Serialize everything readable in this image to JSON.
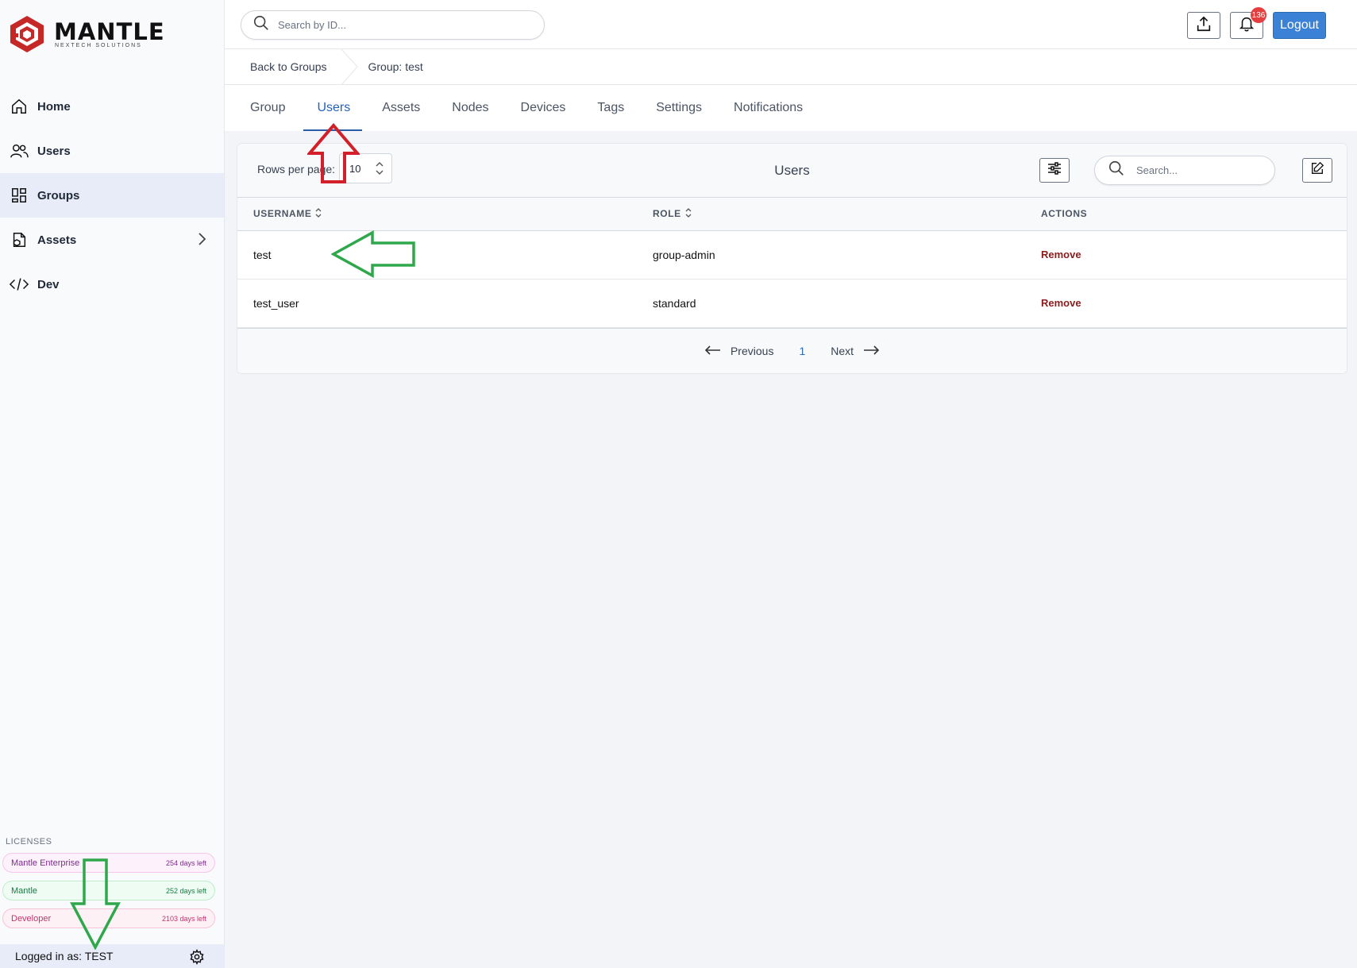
{
  "app": {
    "brand": "MANTLE",
    "brand_sub": "NEXTECH SOLUTIONS"
  },
  "sidebar": {
    "items": [
      {
        "label": "Home",
        "icon": "home-icon"
      },
      {
        "label": "Users",
        "icon": "users-icon"
      },
      {
        "label": "Groups",
        "icon": "groups-icon",
        "active": true
      },
      {
        "label": "Assets",
        "icon": "assets-icon",
        "expandable": true
      },
      {
        "label": "Dev",
        "icon": "code-icon"
      }
    ],
    "licenses_title": "LICENSES",
    "licenses": [
      {
        "name": "Mantle Enterprise",
        "days": "254 days left"
      },
      {
        "name": "Mantle",
        "days": "252 days left"
      },
      {
        "name": "Developer",
        "days": "2103 days left"
      }
    ],
    "logged_in": "Logged in as: TEST"
  },
  "topbar": {
    "search_placeholder": "Search by ID...",
    "notification_count": "136",
    "logout_label": "Logout"
  },
  "breadcrumb": {
    "back": "Back to Groups",
    "current": "Group: test"
  },
  "tabs": [
    {
      "label": "Group"
    },
    {
      "label": "Users",
      "active": true
    },
    {
      "label": "Assets"
    },
    {
      "label": "Nodes"
    },
    {
      "label": "Devices"
    },
    {
      "label": "Tags"
    },
    {
      "label": "Settings"
    },
    {
      "label": "Notifications"
    }
  ],
  "panel": {
    "rows_label": "Rows per page:",
    "rows_value": "10",
    "title": "Users",
    "search_placeholder": "Search...",
    "columns": [
      "USERNAME",
      "ROLE",
      "ACTIONS"
    ],
    "rows": [
      {
        "username": "test",
        "role": "group-admin",
        "action": "Remove"
      },
      {
        "username": "test_user",
        "role": "standard",
        "action": "Remove"
      }
    ],
    "pager": {
      "previous": "Previous",
      "page": "1",
      "next": "Next"
    }
  },
  "colors": {
    "accent": "#2563b8",
    "logout_bg": "#3b82d6",
    "remove": "#8b1c1c",
    "annotation_red": "#d21f2a",
    "annotation_green": "#2ea84a"
  }
}
